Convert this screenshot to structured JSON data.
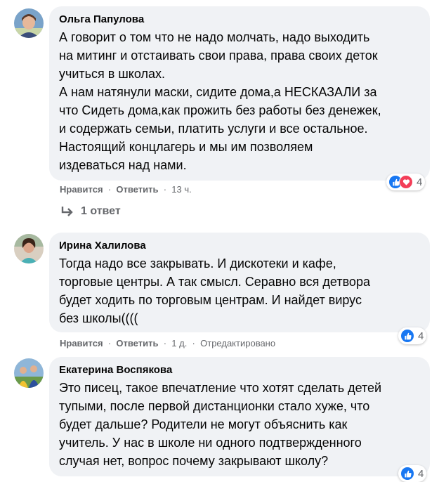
{
  "comments": [
    {
      "author": "Ольга Папулова",
      "lines": [
        "А говорит о том что не надо молчать, надо выходить",
        "на митинг и отстаивать свои права, права своих деток",
        "учиться в школах.",
        "А нам натянули маски, сидите дома,а НЕСКАЗАЛИ за",
        "что Сидеть дома,как прожить без работы без денежек,",
        "и содержать семьи, платить услуги и все остальное.",
        "Настоящий концлагерь и мы им позволяем",
        "издеваться над нами."
      ],
      "like_label": "Нравится",
      "reply_label": "Ответить",
      "time": "13 ч.",
      "reaction_count": "4",
      "reactions": [
        "like-icon",
        "love-icon"
      ],
      "replies_label": "1 ответ"
    },
    {
      "author": "Ирина Халилова",
      "lines": [
        "Тогда надо все закрывать. И дискотеки и кафе,",
        "торговые центры. А так смысл. Серавно вся детвора",
        "будет ходить по торговым центрам. И найдет вирус",
        "без школы(((("
      ],
      "like_label": "Нравится",
      "reply_label": "Ответить",
      "time": "1 д.",
      "edited": "Отредактировано",
      "reaction_count": "4",
      "reactions": [
        "like-icon"
      ]
    },
    {
      "author": "Екатерина Воспякова",
      "lines": [
        "Это писец, такое впечатление что хотят сделать детей",
        "тупыми, после первой дистанционки стало хуже, что",
        "будет дальше? Родители не могут объяснить как",
        "учитель. У нас в школе ни одного подтвержденного",
        "случая нет, вопрос почему закрывают школу?"
      ],
      "reaction_count": "4",
      "reactions": [
        "like-icon"
      ]
    }
  ],
  "separator": "·",
  "colors": {
    "bubble": "#f0f2f5",
    "meta": "#65676b",
    "like": "#1877f2",
    "love": "#f33e58"
  }
}
